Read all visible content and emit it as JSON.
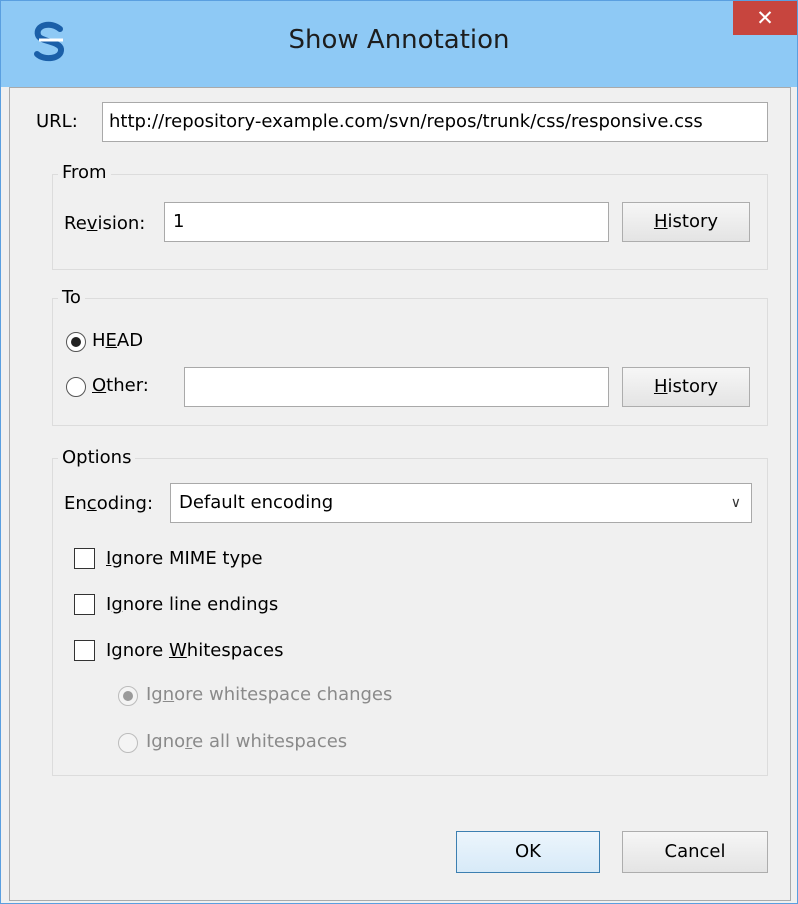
{
  "window": {
    "title": "Show Annotation",
    "close_glyph": "✕",
    "app_icon": "svn-app-icon"
  },
  "url": {
    "label": "URL:",
    "value": "http://repository-example.com/svn/repos/trunk/css/responsive.css"
  },
  "from": {
    "group_title": "From",
    "revision_label": "Revision:",
    "revision_value": "1",
    "history_button": "History"
  },
  "to": {
    "group_title": "To",
    "head_label": "HEAD",
    "head_selected": true,
    "other_label": "Other:",
    "other_value": "",
    "history_button": "History"
  },
  "options": {
    "group_title": "Options",
    "encoding_label": "Encoding:",
    "encoding_value": "Default encoding",
    "ignore_mime_label": "Ignore MIME type",
    "ignore_line_endings_label": "Ignore line endings",
    "ignore_whitespaces_label": "Ignore Whitespaces",
    "ignore_whitespace_changes_label": "Ignore whitespace changes",
    "ignore_all_whitespaces_label": "Ignore all whitespaces"
  },
  "buttons": {
    "ok": "OK",
    "cancel": "Cancel"
  },
  "colors": {
    "titlebar": "#8ec9f5",
    "close": "#c7453e"
  }
}
